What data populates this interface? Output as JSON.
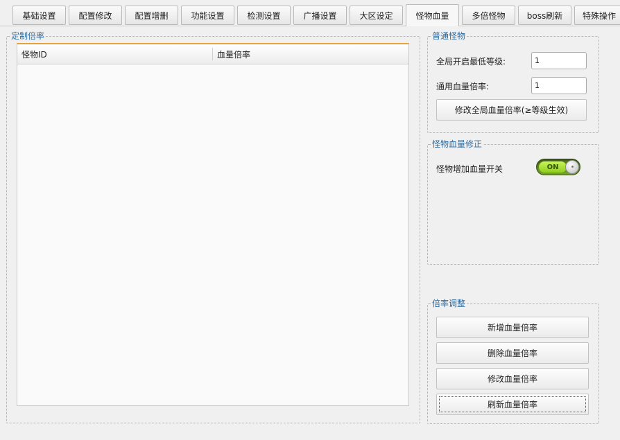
{
  "tabs": [
    {
      "label": "基础设置",
      "active": false
    },
    {
      "label": "配置修改",
      "active": false
    },
    {
      "label": "配置增删",
      "active": false
    },
    {
      "label": "功能设置",
      "active": false
    },
    {
      "label": "检测设置",
      "active": false
    },
    {
      "label": "广播设置",
      "active": false
    },
    {
      "label": "大区设定",
      "active": false
    },
    {
      "label": "怪物血量",
      "active": true
    },
    {
      "label": "多倍怪物",
      "active": false
    },
    {
      "label": "boss刷新",
      "active": false
    },
    {
      "label": "特殊操作",
      "active": false
    }
  ],
  "custom_rate": {
    "legend": "定制倍率",
    "columns": [
      "怪物ID",
      "血量倍率"
    ],
    "rows": []
  },
  "normal_monster": {
    "legend": "普通怪物",
    "min_level_label": "全局开启最低等级:",
    "min_level_value": "1",
    "hp_rate_label": "通用血量倍率:",
    "hp_rate_value": "1",
    "modify_button": "修改全局血量倍率(≥等级生效)"
  },
  "hp_fix": {
    "legend": "怪物血量修正",
    "switch_label": "怪物增加血量开关",
    "switch_state": "ON",
    "switch_color": "#8fcf1f"
  },
  "rate_adjust": {
    "legend": "倍率调整",
    "add_button": "新增血量倍率",
    "delete_button": "删除血量倍率",
    "modify_button": "修改血量倍率",
    "refresh_button": "刷新血量倍率"
  }
}
